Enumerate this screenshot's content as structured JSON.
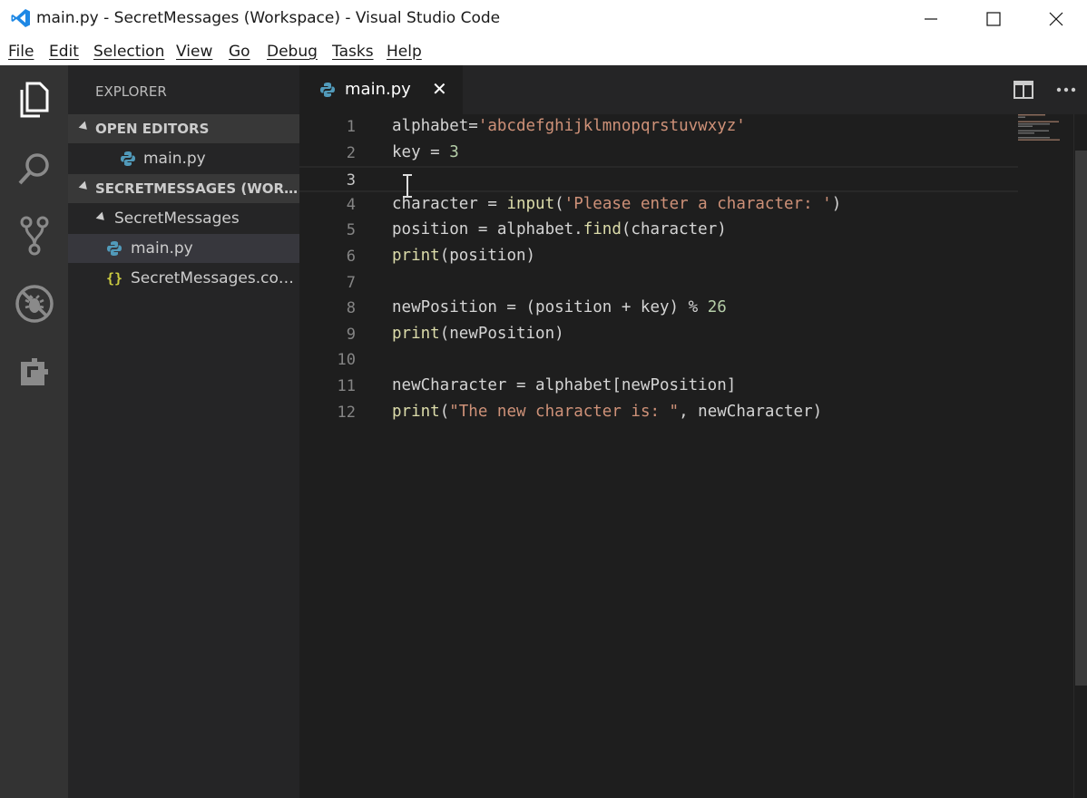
{
  "window": {
    "title": "main.py - SecretMessages (Workspace) - Visual Studio Code",
    "accent": "#007acc"
  },
  "menu": [
    "File",
    "Edit",
    "Selection",
    "View",
    "Go",
    "Debug",
    "Tasks",
    "Help"
  ],
  "sidebar": {
    "header": "EXPLORER",
    "open_editors_label": "OPEN EDITORS",
    "open_editors": [
      {
        "label": "main.py",
        "icon": "python-icon"
      }
    ],
    "workspace_label": "SECRETMESSAGES (WORKSPACE)",
    "folder_label": "SecretMessages",
    "files": [
      {
        "label": "main.py",
        "icon": "python-icon"
      },
      {
        "label": "SecretMessages.code-workspace",
        "icon": "json-braces-icon"
      }
    ]
  },
  "tab": {
    "label": "main.py",
    "close": "✕"
  },
  "editor": {
    "active_line": 3,
    "lines": [
      {
        "n": "1",
        "tokens": [
          [
            "plain",
            "alphabet="
          ],
          [
            "str",
            "'abcdefghijklmnopqrstuvwxyz'"
          ]
        ]
      },
      {
        "n": "2",
        "tokens": [
          [
            "plain",
            "key = "
          ],
          [
            "num",
            "3"
          ]
        ]
      },
      {
        "n": "3",
        "tokens": []
      },
      {
        "n": "4",
        "tokens": [
          [
            "plain",
            "character = "
          ],
          [
            "fn",
            "input"
          ],
          [
            "plain",
            "("
          ],
          [
            "str",
            "'Please enter a character: '"
          ],
          [
            "plain",
            ")"
          ]
        ]
      },
      {
        "n": "5",
        "tokens": [
          [
            "plain",
            "position = alphabet."
          ],
          [
            "fn",
            "find"
          ],
          [
            "plain",
            "(character)"
          ]
        ]
      },
      {
        "n": "6",
        "tokens": [
          [
            "fn",
            "print"
          ],
          [
            "plain",
            "(position)"
          ]
        ]
      },
      {
        "n": "7",
        "tokens": []
      },
      {
        "n": "8",
        "tokens": [
          [
            "plain",
            "newPosition = (position + key) % "
          ],
          [
            "num",
            "26"
          ]
        ]
      },
      {
        "n": "9",
        "tokens": [
          [
            "fn",
            "print"
          ],
          [
            "plain",
            "(newPosition)"
          ]
        ]
      },
      {
        "n": "10",
        "tokens": []
      },
      {
        "n": "11",
        "tokens": [
          [
            "plain",
            "newCharacter = alphabet[newPosition]"
          ]
        ]
      },
      {
        "n": "12",
        "tokens": [
          [
            "fn",
            "print"
          ],
          [
            "plain",
            "("
          ],
          [
            "str",
            "\"The new character is: \""
          ],
          [
            "plain",
            ", newCharacter)"
          ]
        ]
      }
    ]
  },
  "activity_icons": [
    "files-icon",
    "search-icon",
    "source-control-icon",
    "debug-icon",
    "extensions-icon"
  ]
}
